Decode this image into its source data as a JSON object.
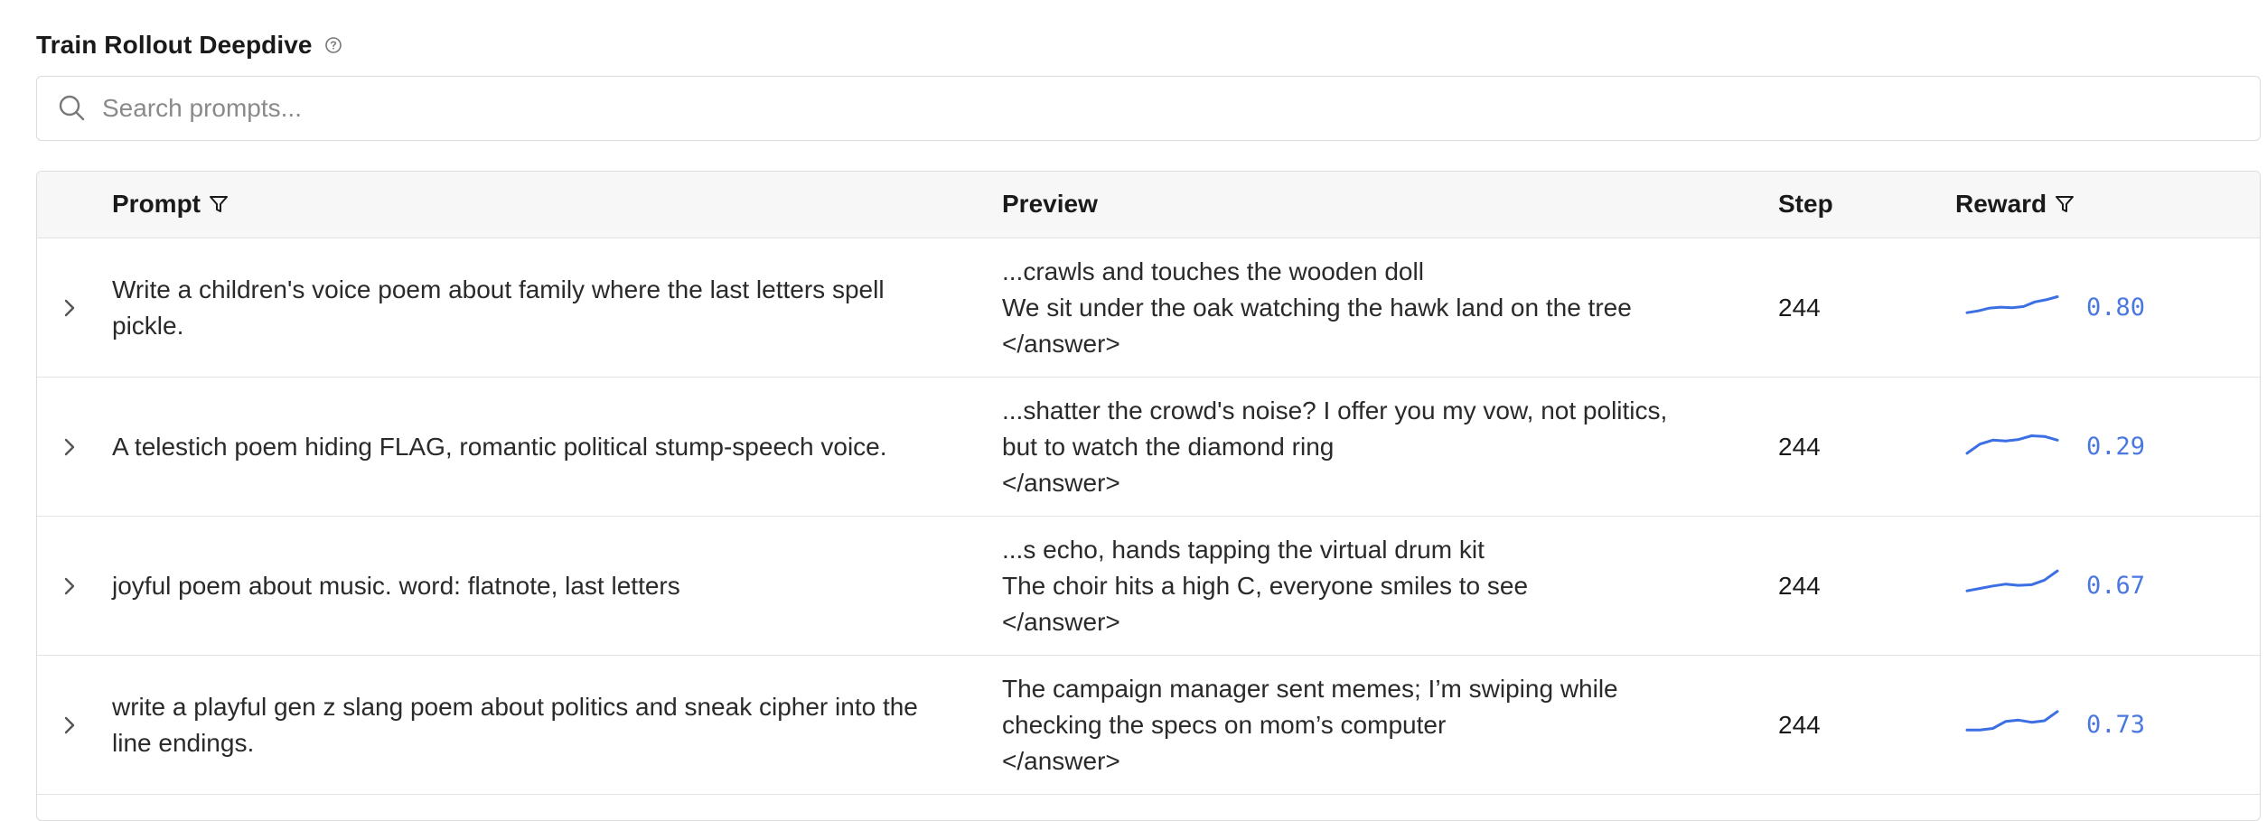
{
  "header": {
    "title": "Train Rollout Deepdive",
    "help_icon": "help-circle-icon"
  },
  "search": {
    "placeholder": "Search prompts...",
    "value": "",
    "icon": "search-icon"
  },
  "table": {
    "columns": {
      "prompt": "Prompt",
      "preview": "Preview",
      "step": "Step",
      "reward": "Reward"
    },
    "rows": [
      {
        "prompt": "Write a children's voice poem about family where the last letters spell pickle.",
        "preview": [
          "...crawls and touches the wooden doll",
          "We sit under the oak watching the hawk land on the tree",
          "</answer>"
        ],
        "step": "244",
        "reward": "0.80",
        "sparkline": [
          0.2,
          0.26,
          0.35,
          0.38,
          0.36,
          0.4,
          0.55,
          0.62,
          0.72
        ]
      },
      {
        "prompt": "A telestich poem hiding FLAG, romantic political stump-speech voice.",
        "preview": [
          "...shatter the crowd's noise? I offer you my vow, not politics,",
          "but to watch the diamond ring",
          "</answer>"
        ],
        "step": "244",
        "reward": "0.29",
        "sparkline": [
          0.15,
          0.45,
          0.58,
          0.55,
          0.6,
          0.72,
          0.7,
          0.58
        ]
      },
      {
        "prompt": "joyful poem about music. word: flatnote, last letters",
        "preview": [
          "...s echo, hands tapping the virtual drum kit",
          "The choir hits a high C, everyone smiles to see",
          "</answer>"
        ],
        "step": "244",
        "reward": "0.67",
        "sparkline": [
          0.2,
          0.28,
          0.36,
          0.42,
          0.38,
          0.4,
          0.55,
          0.85
        ]
      },
      {
        "prompt": "write a playful gen z slang poem about politics and sneak cipher into the line endings.",
        "preview": [
          "The campaign manager sent memes; I’m swiping while",
          "checking the specs on mom’s computer",
          "</answer>"
        ],
        "step": "244",
        "reward": "0.73",
        "sparkline": [
          0.2,
          0.2,
          0.25,
          0.48,
          0.52,
          0.45,
          0.5,
          0.8
        ]
      }
    ]
  },
  "colors": {
    "accent": "#3b6fe3",
    "reward": "#4a78e0",
    "header_bg": "#f7f7f7",
    "border": "#dcdcdc"
  },
  "icons": {
    "expand": "chevron-right-icon",
    "filter": "filter-icon"
  }
}
